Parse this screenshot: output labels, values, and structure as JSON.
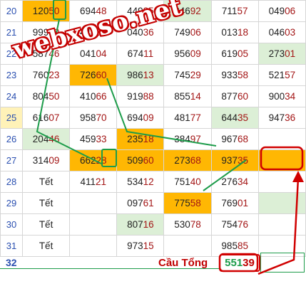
{
  "rows": [
    {
      "day": "20",
      "cells": [
        {
          "a": "120",
          "b": "50",
          "bg": "y"
        },
        {
          "a": "694",
          "b": "48",
          "bg": "w"
        },
        {
          "a": "449",
          "b": "25",
          "bg": "w"
        },
        {
          "a": "246",
          "b": "92",
          "bg": "g"
        },
        {
          "a": "711",
          "b": "57",
          "bg": "w"
        },
        {
          "a": "049",
          "b": "06",
          "bg": "w"
        }
      ]
    },
    {
      "day": "21",
      "cells": [
        {
          "a": "999",
          "b": "69",
          "bg": "w"
        },
        {
          "a": "449",
          "b": "93",
          "bg": "w"
        },
        {
          "a": "040",
          "b": "36",
          "bg": "w"
        },
        {
          "a": "749",
          "b": "06",
          "bg": "w"
        },
        {
          "a": "013",
          "b": "18",
          "bg": "w"
        },
        {
          "a": "046",
          "b": "03",
          "bg": "w"
        }
      ]
    },
    {
      "day": "22",
      "cells": [
        {
          "a": "587",
          "b": "46",
          "bg": "w"
        },
        {
          "a": "041",
          "b": "04",
          "bg": "w"
        },
        {
          "a": "674",
          "b": "11",
          "bg": "w"
        },
        {
          "a": "956",
          "b": "09",
          "bg": "w"
        },
        {
          "a": "619",
          "b": "05",
          "bg": "w"
        },
        {
          "a": "273",
          "b": "01",
          "bg": "g"
        }
      ]
    },
    {
      "day": "23",
      "cells": [
        {
          "a": "760",
          "b": "23",
          "bg": "w"
        },
        {
          "a": "726",
          "b": "60",
          "bg": "y"
        },
        {
          "a": "986",
          "b": "13",
          "bg": "g"
        },
        {
          "a": "745",
          "b": "29",
          "bg": "w"
        },
        {
          "a": "933",
          "b": "58",
          "bg": "w"
        },
        {
          "a": "521",
          "b": "57",
          "bg": "w"
        }
      ]
    },
    {
      "day": "24",
      "cells": [
        {
          "a": "804",
          "b": "50",
          "bg": "w"
        },
        {
          "a": "410",
          "b": "66",
          "bg": "w"
        },
        {
          "a": "919",
          "b": "88",
          "bg": "w"
        },
        {
          "a": "855",
          "b": "14",
          "bg": "w"
        },
        {
          "a": "877",
          "b": "60",
          "bg": "w"
        },
        {
          "a": "900",
          "b": "34",
          "bg": "w"
        }
      ]
    },
    {
      "day": "25",
      "highlight": true,
      "cells": [
        {
          "a": "616",
          "b": "07",
          "bg": "w"
        },
        {
          "a": "958",
          "b": "70",
          "bg": "w"
        },
        {
          "a": "694",
          "b": "09",
          "bg": "w"
        },
        {
          "a": "481",
          "b": "77",
          "bg": "w"
        },
        {
          "a": "644",
          "b": "35",
          "bg": "g"
        },
        {
          "a": "947",
          "b": "36",
          "bg": "w"
        }
      ]
    },
    {
      "day": "26",
      "cells": [
        {
          "a": "204",
          "b": "46",
          "bg": "g"
        },
        {
          "a": "459",
          "b": "33",
          "bg": "w"
        },
        {
          "a": "235",
          "b": "18",
          "bg": "y"
        },
        {
          "a": "384",
          "b": "97",
          "bg": "w"
        },
        {
          "a": "967",
          "b": "68",
          "bg": "w"
        },
        {
          "a": "",
          "b": "",
          "bg": "w"
        }
      ]
    },
    {
      "day": "27",
      "cells": [
        {
          "a": "314",
          "b": "09",
          "bg": "w"
        },
        {
          "a": "662",
          "b": "28",
          "bg": "y"
        },
        {
          "a": "509",
          "b": "60",
          "bg": "y"
        },
        {
          "a": "273",
          "b": "68",
          "bg": "y"
        },
        {
          "a": "937",
          "b": "35",
          "bg": "y"
        },
        {
          "a": "",
          "b": "",
          "bg": "y"
        }
      ]
    },
    {
      "day": "28",
      "cells": [
        {
          "text": "Tết",
          "bg": "w"
        },
        {
          "a": "411",
          "b": "21",
          "bg": "w"
        },
        {
          "a": "534",
          "b": "12",
          "bg": "w"
        },
        {
          "a": "751",
          "b": "40",
          "bg": "w"
        },
        {
          "a": "276",
          "b": "34",
          "bg": "w"
        },
        {
          "a": "",
          "b": "",
          "bg": "w"
        }
      ]
    },
    {
      "day": "29",
      "cells": [
        {
          "text": "Tết",
          "bg": "w"
        },
        {
          "a": "",
          "b": "",
          "bg": "w"
        },
        {
          "a": "097",
          "b": "61",
          "bg": "w"
        },
        {
          "a": "775",
          "b": "58",
          "bg": "y"
        },
        {
          "a": "769",
          "b": "01",
          "bg": "w"
        },
        {
          "a": "",
          "b": "",
          "bg": "g"
        }
      ]
    },
    {
      "day": "30",
      "cells": [
        {
          "text": "Tết",
          "bg": "w"
        },
        {
          "a": "",
          "b": "",
          "bg": "w"
        },
        {
          "a": "807",
          "b": "16",
          "bg": "g"
        },
        {
          "a": "530",
          "b": "78",
          "bg": "w"
        },
        {
          "a": "754",
          "b": "76",
          "bg": "w"
        },
        {
          "a": "",
          "b": "",
          "bg": "w"
        }
      ]
    },
    {
      "day": "31",
      "cells": [
        {
          "text": "Tết",
          "bg": "w"
        },
        {
          "a": "",
          "b": "",
          "bg": "w"
        },
        {
          "a": "973",
          "b": "15",
          "bg": "w"
        },
        {
          "a": "",
          "b": "",
          "bg": "w"
        },
        {
          "a": "985",
          "b": "85",
          "bg": "w"
        },
        {
          "a": "",
          "b": "",
          "bg": "w"
        }
      ]
    }
  ],
  "footer": {
    "day": "32",
    "label": "Cầu Tổng",
    "sum_a": "551",
    "sum_b": "39"
  },
  "watermark": "webxoso.net",
  "colors": {
    "highlight_yellow": "#ffb703",
    "pale_green": "#dcefd6",
    "day_blue": "#2a4fb0",
    "accent_red": "#d00000",
    "line_green": "#1d9c4a"
  }
}
